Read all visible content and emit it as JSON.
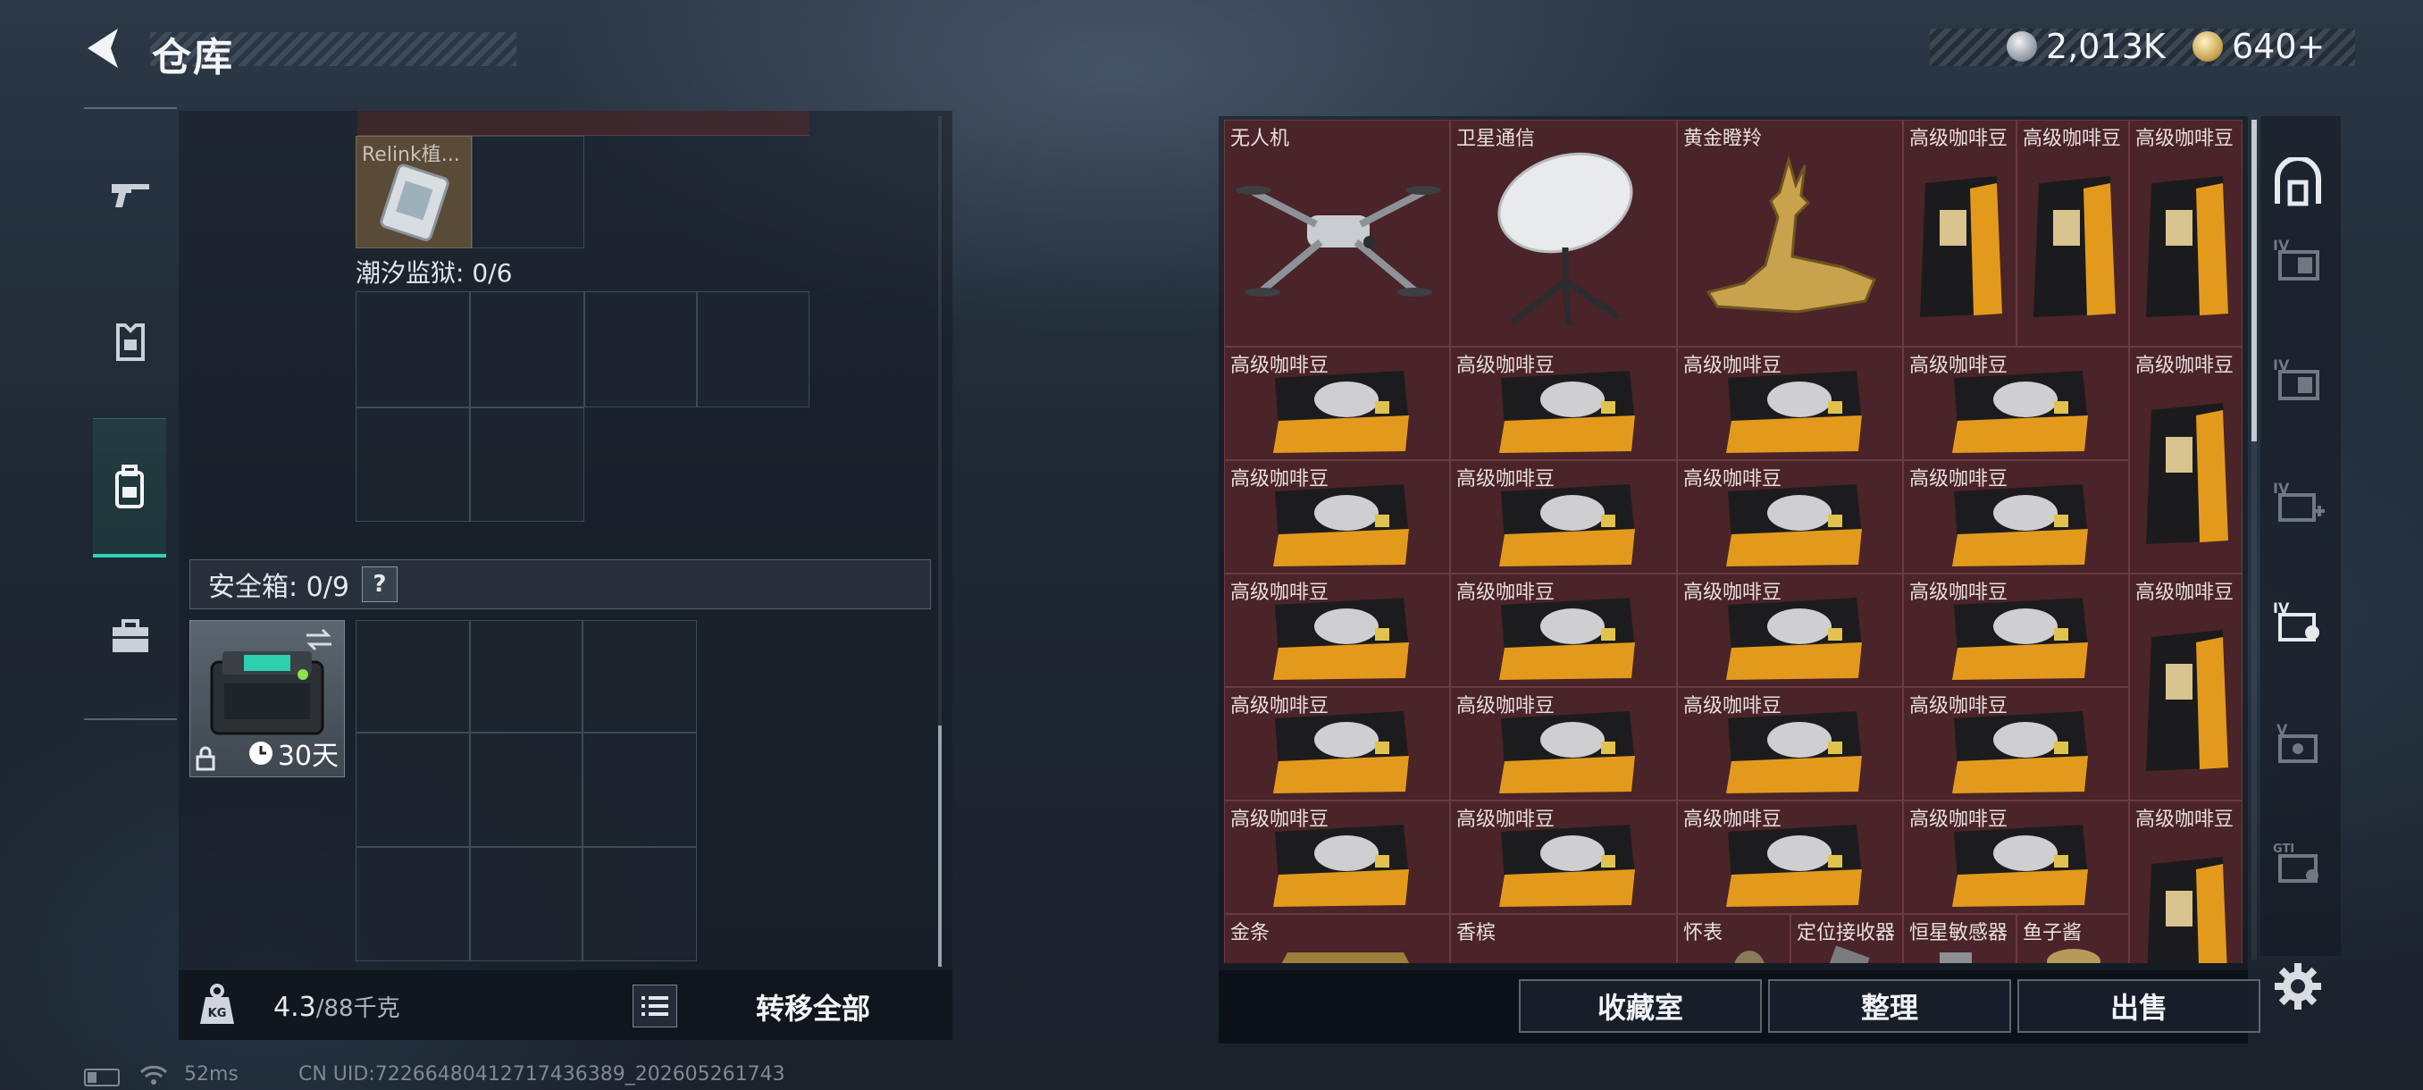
{
  "header": {
    "title": "仓库",
    "currency_silver": "2,013K",
    "currency_gold": "640+"
  },
  "left_panel": {
    "relink_label": "Relink植...",
    "container_label": "潮汐监狱: 0/6",
    "safe_box_label": "安全箱: 0/9",
    "safe_box_help": "?",
    "safe_box_timer": "30天",
    "weight_current": "4.3",
    "weight_capacity": "/88千克",
    "transfer_all": "转移全部"
  },
  "stash": {
    "items": [
      {
        "name": "无人机",
        "icon": "drone"
      },
      {
        "name": "卫星通信",
        "icon": "satellite-dish"
      },
      {
        "name": "黄金瞪羚",
        "icon": "golden-gazelle"
      },
      {
        "name": "高级咖啡豆",
        "icon": "coffee-bag-tall"
      },
      {
        "name": "高级咖啡豆",
        "icon": "coffee-bag-flat"
      },
      {
        "name": "金条",
        "icon": "gold-bar"
      },
      {
        "name": "香槟",
        "icon": "champagne"
      },
      {
        "name": "怀表",
        "icon": "pocket-watch"
      },
      {
        "name": "定位接收器",
        "icon": "locator-receiver"
      },
      {
        "name": "恒星敏感器",
        "icon": "star-sensor"
      },
      {
        "name": "鱼子酱",
        "icon": "caviar"
      }
    ]
  },
  "actions": {
    "collection": "收藏室",
    "organize": "整理",
    "sell": "出售"
  },
  "status_bar": {
    "ping": "52ms",
    "uid": "CN UID:7226648041271743638‌9_202605261743"
  },
  "colors": {
    "accent_teal": "#31d3b4",
    "stash_slot_bg": "#4a2428"
  }
}
